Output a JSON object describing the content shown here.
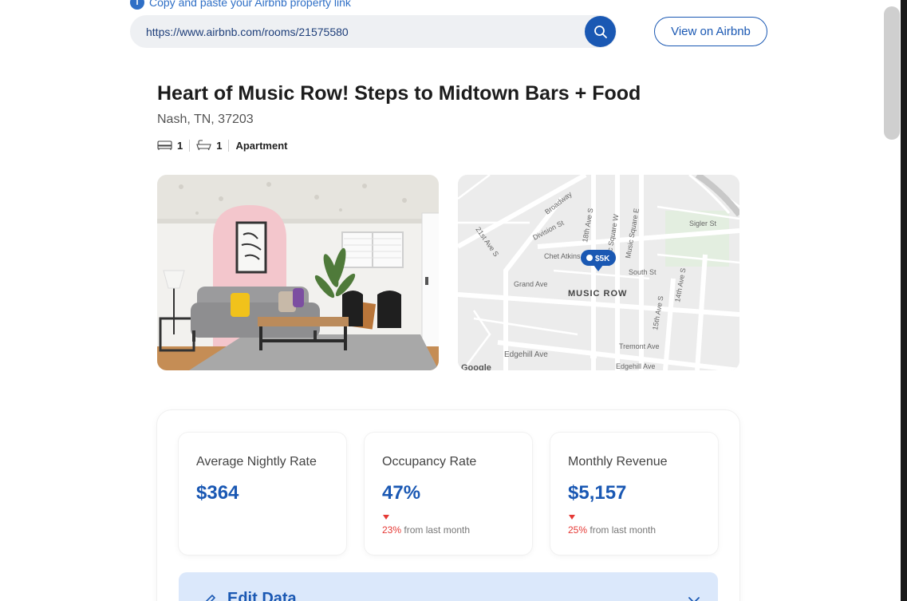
{
  "hint": {
    "text": "Copy and paste your Airbnb property link",
    "icon": "info-icon"
  },
  "search": {
    "value": "https://www.airbnb.com/rooms/21575580",
    "icon": "search-icon"
  },
  "view_button": {
    "label": "View on Airbnb"
  },
  "listing": {
    "title": "Heart of Music Row! Steps to Midtown Bars + Food",
    "address": "Nash, TN, 37203",
    "specs": [
      {
        "icon": "bed-icon",
        "value": "1"
      },
      {
        "icon": "bath-icon",
        "value": "1"
      },
      {
        "icon": "",
        "value": "Apartment"
      }
    ]
  },
  "map": {
    "labels": {
      "broadway": "Broadway",
      "division": "Division St",
      "ave21": "21st Ave S",
      "ave18": "18th Ave S",
      "sqw": "Music Square W",
      "sqe": "Music Square E",
      "sigler": "Sigler St",
      "chet": "Chet Atkins",
      "grand": "Grand Ave",
      "south": "South St",
      "ave14": "14th Ave S",
      "ave15": "15th Ave S",
      "area": "MUSIC ROW",
      "tremont": "Tremont Ave",
      "edgehill1": "Edgehill Ave",
      "edgehill2": "Edgehill Ave",
      "google": "Google"
    },
    "marker": "$5K"
  },
  "stats": [
    {
      "label": "Average Nightly Rate",
      "value": "$364"
    },
    {
      "label": "Occupancy Rate",
      "value": "47%",
      "change_pct": "23%",
      "change_text": "from last month"
    },
    {
      "label": "Monthly Revenue",
      "value": "$5,157",
      "change_pct": "25%",
      "change_text": "from last month"
    }
  ],
  "edit": {
    "label": "Edit Data",
    "icon": "pencil-icon",
    "toggle_icon": "chevron-down-icon"
  },
  "colors": {
    "accent": "#1a58b3",
    "negative": "#e53935"
  }
}
